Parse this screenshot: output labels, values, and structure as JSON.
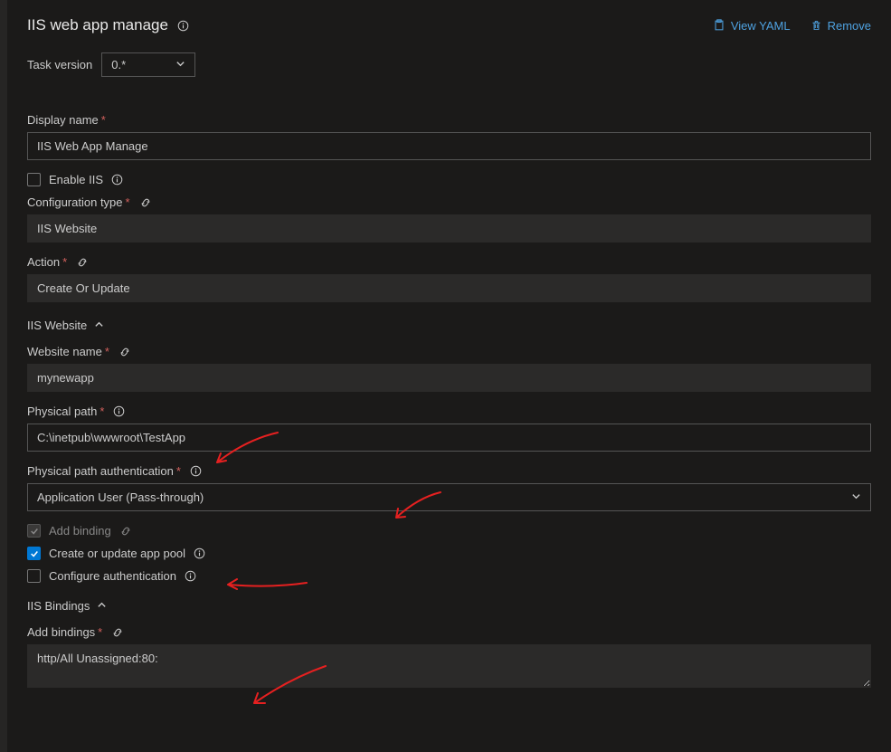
{
  "header": {
    "title": "IIS web app manage",
    "viewYaml": "View YAML",
    "remove": "Remove"
  },
  "taskVersion": {
    "label": "Task version",
    "value": "0.*"
  },
  "fields": {
    "displayName": {
      "label": "Display name",
      "value": "IIS Web App Manage"
    },
    "enableIIS": {
      "label": "Enable IIS"
    },
    "configType": {
      "label": "Configuration type",
      "value": "IIS Website"
    },
    "action": {
      "label": "Action",
      "value": "Create Or Update"
    }
  },
  "section1": {
    "title": "IIS Website",
    "websiteName": {
      "label": "Website name",
      "value": "mynewapp"
    },
    "physicalPath": {
      "label": "Physical path",
      "value": "C:\\inetpub\\wwwroot\\TestApp"
    },
    "physicalPathAuth": {
      "label": "Physical path authentication",
      "value": "Application User (Pass-through)"
    },
    "addBinding": {
      "label": "Add binding"
    },
    "createAppPool": {
      "label": "Create or update app pool"
    },
    "configureAuth": {
      "label": "Configure authentication"
    }
  },
  "section2": {
    "title": "IIS Bindings",
    "addBindings": {
      "label": "Add bindings",
      "value": "http/All Unassigned:80:"
    }
  }
}
